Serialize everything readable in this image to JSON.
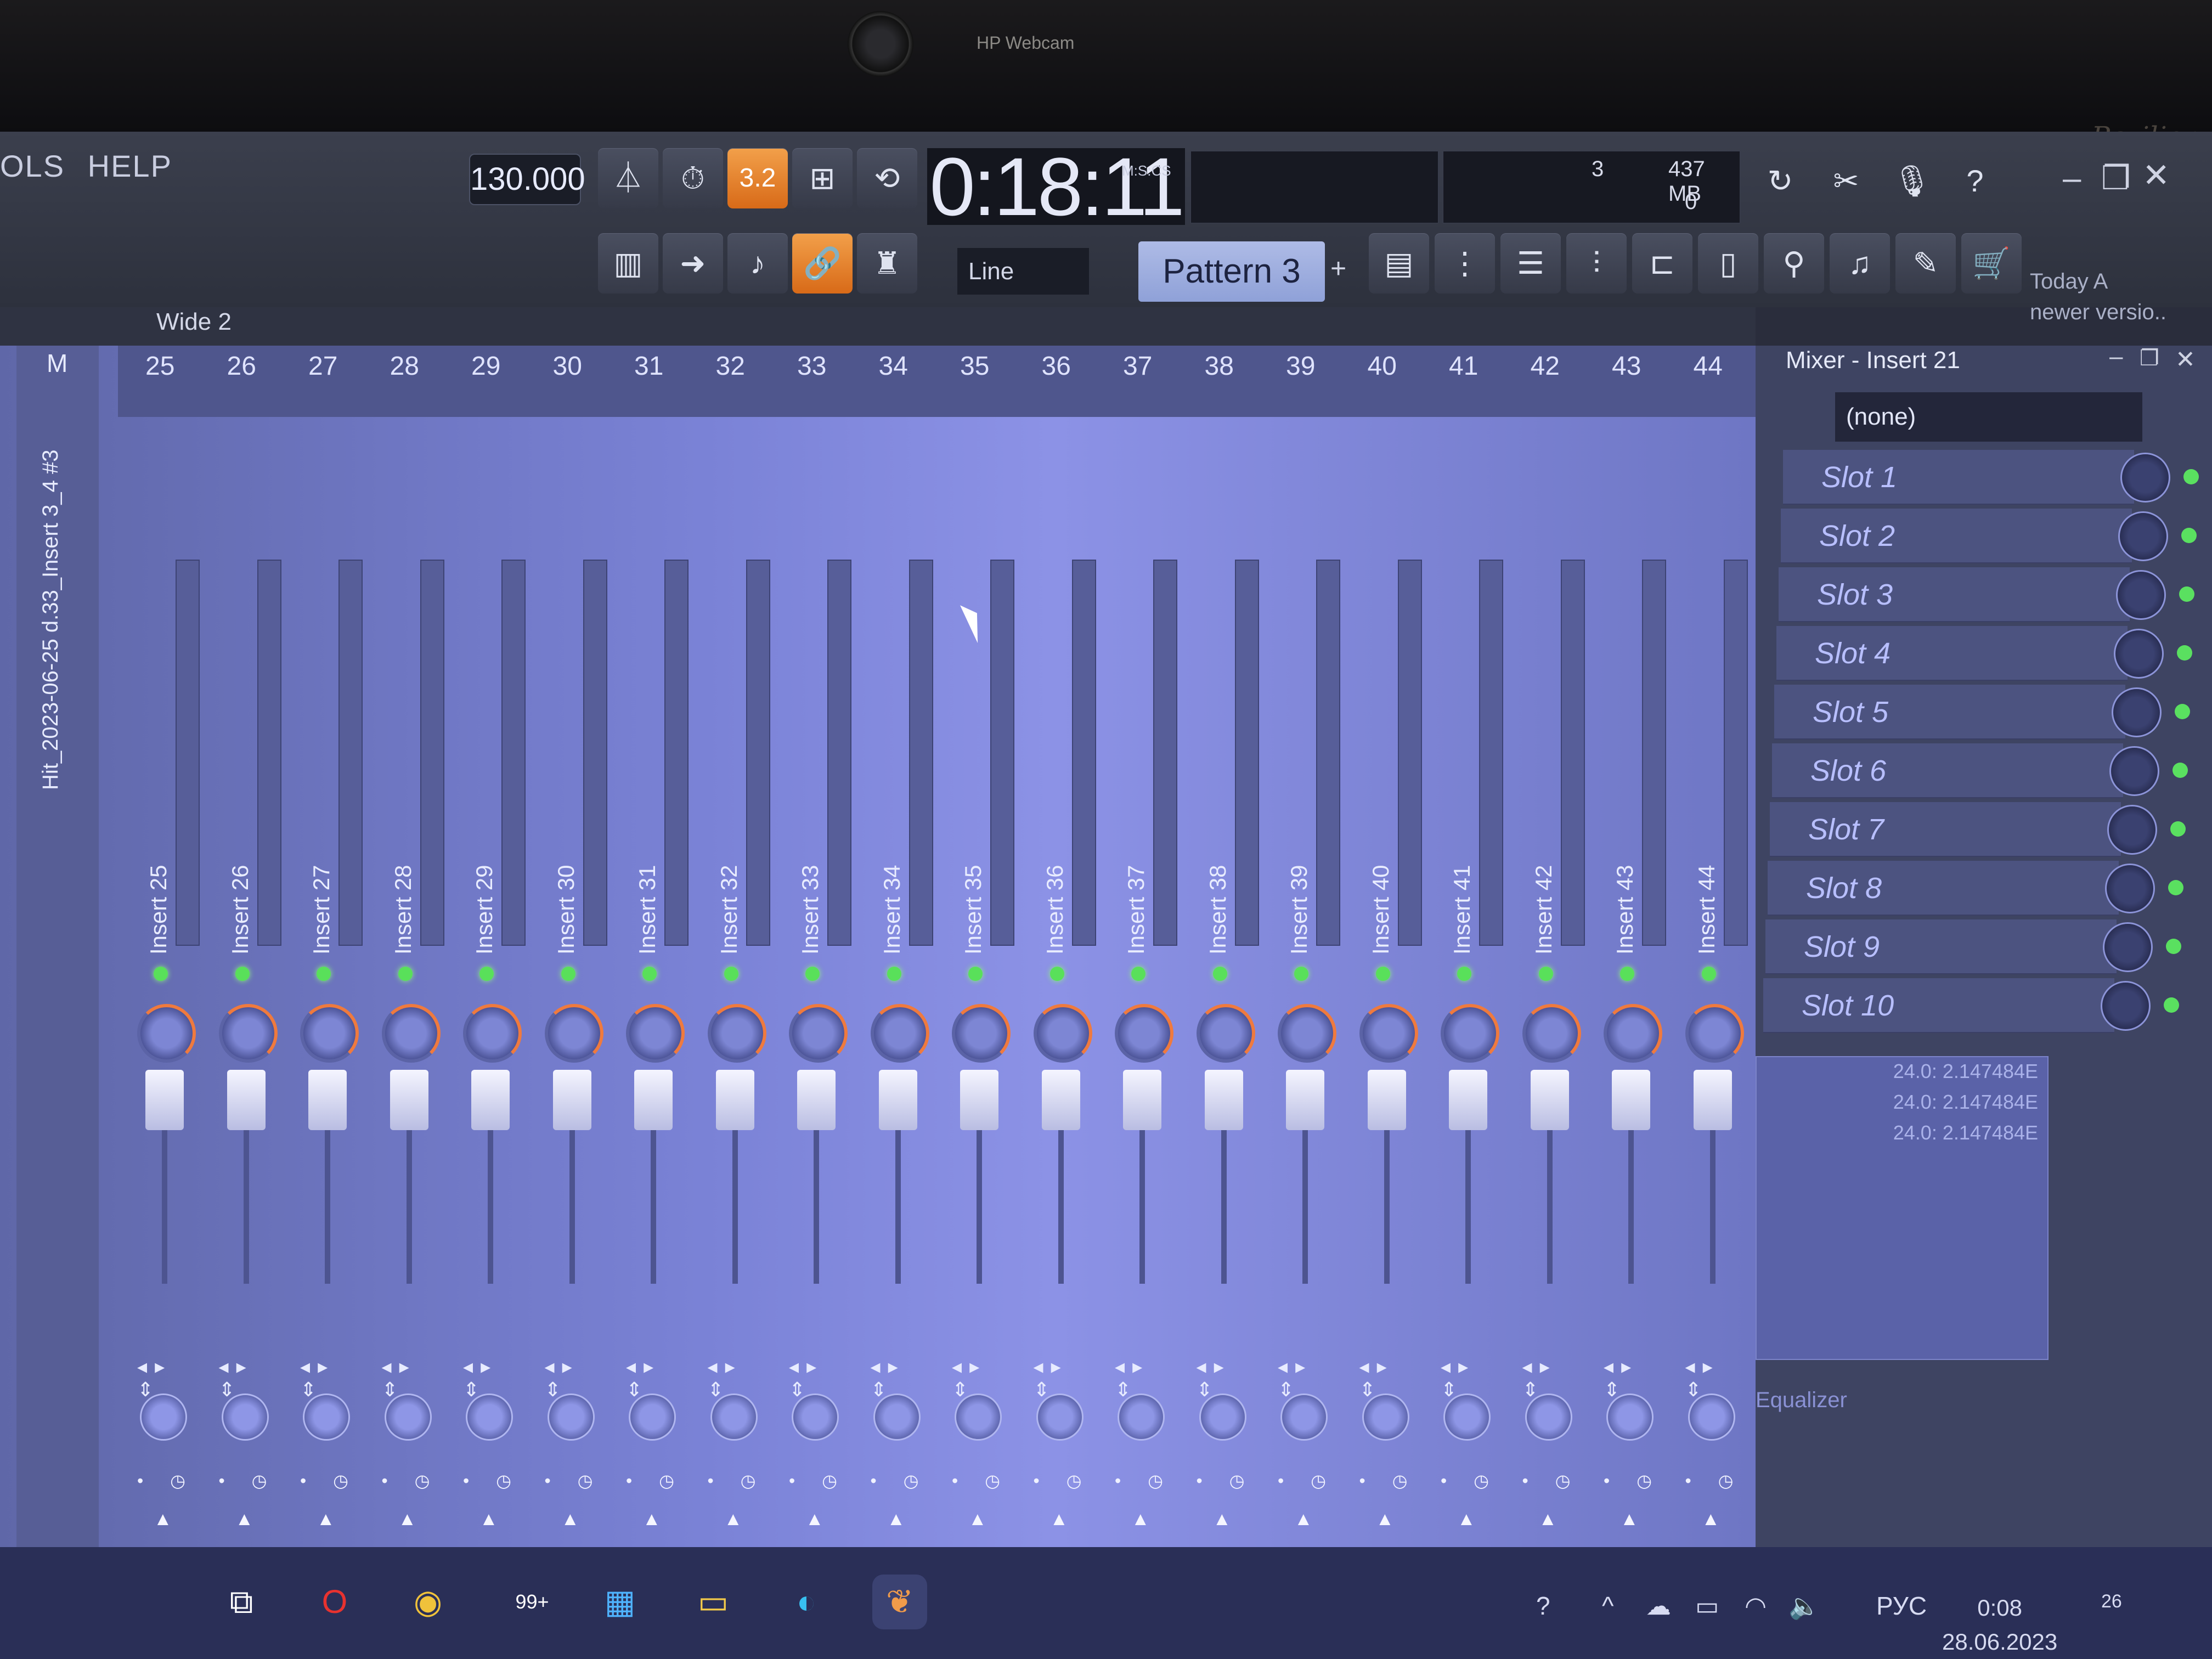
{
  "hardware": {
    "webcam_label": "HP Webcam",
    "brand": "Pavilion"
  },
  "menu": [
    "OLS",
    "HELP"
  ],
  "transport": {
    "tempo": "130.000",
    "time": "0:18:11",
    "time_unit": "M:S:CS",
    "cpu_value": "3",
    "memory": "437 MB",
    "poly": "0",
    "snap_mode": "Line",
    "pattern": "Pattern 3",
    "pattern_add": "+",
    "orange_button": "3.2"
  },
  "news": {
    "line1": "Today  A",
    "line2": "newer versio.."
  },
  "playlist_bar": {
    "label": "Wide 2"
  },
  "master": {
    "label": "M",
    "track_name": "Hit_2023-06-25 d.33_Insert 3_4 #3"
  },
  "mixer": {
    "inserts": [
      {
        "num": "25",
        "name": "Insert 25"
      },
      {
        "num": "26",
        "name": "Insert 26"
      },
      {
        "num": "27",
        "name": "Insert 27"
      },
      {
        "num": "28",
        "name": "Insert 28"
      },
      {
        "num": "29",
        "name": "Insert 29"
      },
      {
        "num": "30",
        "name": "Insert 30"
      },
      {
        "num": "31",
        "name": "Insert 31"
      },
      {
        "num": "32",
        "name": "Insert 32"
      },
      {
        "num": "33",
        "name": "Insert 33"
      },
      {
        "num": "34",
        "name": "Insert 34"
      },
      {
        "num": "35",
        "name": "Insert 35"
      },
      {
        "num": "36",
        "name": "Insert 36"
      },
      {
        "num": "37",
        "name": "Insert 37"
      },
      {
        "num": "38",
        "name": "Insert 38"
      },
      {
        "num": "39",
        "name": "Insert 39"
      },
      {
        "num": "40",
        "name": "Insert 40"
      },
      {
        "num": "41",
        "name": "Insert 41"
      },
      {
        "num": "42",
        "name": "Insert 42"
      },
      {
        "num": "43",
        "name": "Insert 43"
      },
      {
        "num": "44",
        "name": "Insert 44"
      }
    ]
  },
  "panel": {
    "title": "Mixer - Insert 21",
    "input": "(none)",
    "slots": [
      "Slot 1",
      "Slot 2",
      "Slot 3",
      "Slot 4",
      "Slot 5",
      "Slot 6",
      "Slot 7",
      "Slot 8",
      "Slot 9",
      "Slot 10"
    ],
    "values": [
      "24.0: 2.147484E",
      "24.0: 2.147484E",
      "24.0: 2.147484E"
    ],
    "equalizer": "Equalizer"
  },
  "taskbar": {
    "badge": "99+",
    "lang": "РУС",
    "time": "0:08",
    "date": "28.06.2023",
    "notif": "26"
  }
}
